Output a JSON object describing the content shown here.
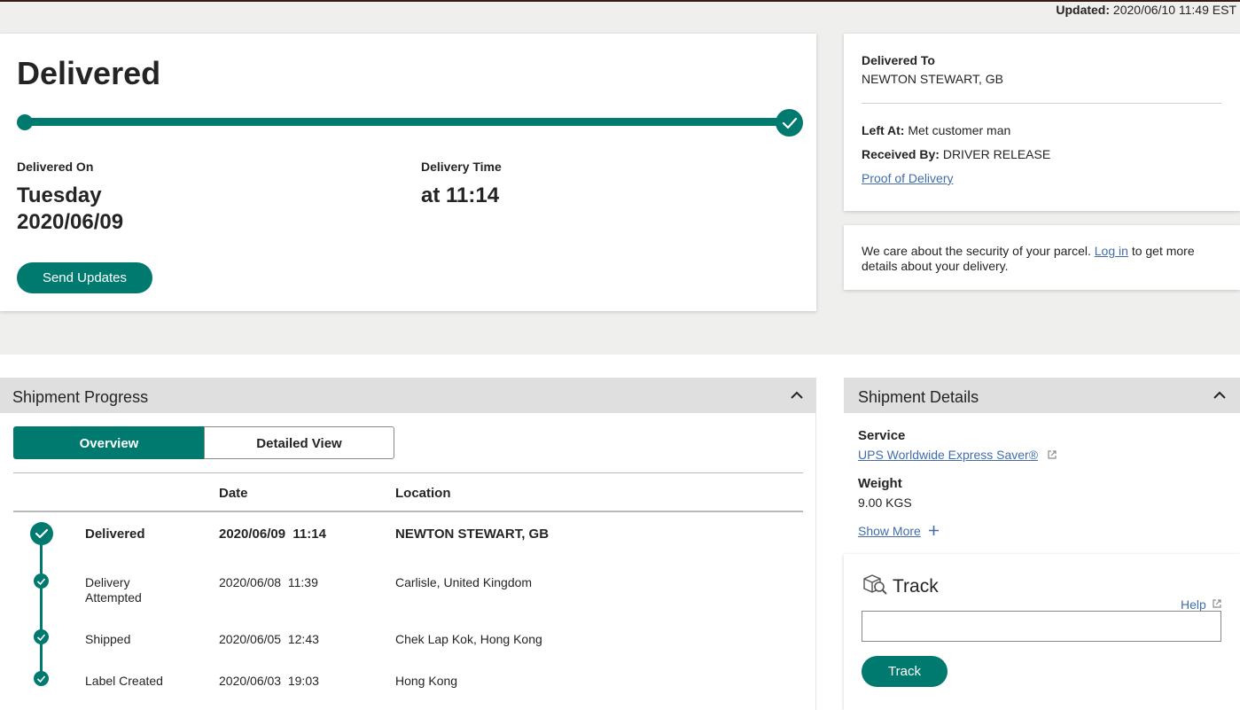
{
  "header": {
    "updated_label": "Updated:",
    "updated_value": "2020/06/10 11:49 EST"
  },
  "status": {
    "title": "Delivered",
    "progress_percent": 100,
    "delivered_on_label": "Delivered On",
    "delivered_on_day": "Tuesday",
    "delivered_on_date": "2020/06/09",
    "delivery_time_label": "Delivery Time",
    "delivery_time_value": "at 11:14",
    "send_updates_label": "Send Updates"
  },
  "delivered_to": {
    "label": "Delivered To",
    "value": "NEWTON STEWART, GB",
    "left_at_label": "Left At:",
    "left_at_value": "Met customer man",
    "received_by_label": "Received By:",
    "received_by_value": "DRIVER RELEASE",
    "proof_link": "Proof of Delivery"
  },
  "security": {
    "text_before": "We care about the security of your parcel.",
    "login_link": "Log in",
    "text_after": "to get more",
    "text_line2": "details about your delivery."
  },
  "progress": {
    "title": "Shipment Progress",
    "tabs": [
      {
        "label": "Overview",
        "active": true
      },
      {
        "label": "Detailed View",
        "active": false
      }
    ],
    "columns": {
      "date": "Date",
      "location": "Location"
    },
    "rows": [
      {
        "status": "Delivered",
        "status_line2": "",
        "date": "2020/06/09",
        "time": "11:14",
        "location": "NEWTON STEWART, GB"
      },
      {
        "status": "Delivery",
        "status_line2": "Attempted",
        "date": "2020/06/08",
        "time": "11:39",
        "location": "Carlisle, United Kingdom"
      },
      {
        "status": "Shipped",
        "status_line2": "",
        "date": "2020/06/05",
        "time": "12:43",
        "location": "Chek Lap Kok, Hong Kong"
      },
      {
        "status": "Label Created",
        "status_line2": "",
        "date": "2020/06/03",
        "time": "19:03",
        "location": "Hong Kong"
      }
    ]
  },
  "details": {
    "title": "Shipment Details",
    "service_label": "Service",
    "service_value": "UPS Worldwide Express Saver®",
    "weight_label": "Weight",
    "weight_value": "9.00 KGS",
    "show_more": "Show More"
  },
  "track": {
    "title": "Track",
    "help": "Help",
    "input_value": "",
    "button": "Track"
  },
  "colors": {
    "accent": "#007a6e",
    "link": "#426da9",
    "panel_header": "#dfdfdf",
    "background": "#efefee"
  }
}
